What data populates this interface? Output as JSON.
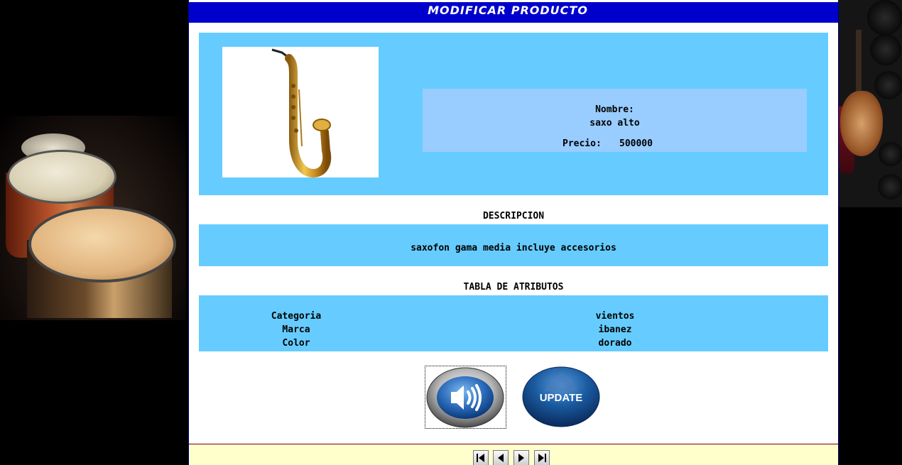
{
  "header": {
    "title": "MODIFICAR PRODUCTO"
  },
  "product": {
    "image_icon": "saxophone-image",
    "name_label": "Nombre:",
    "name_value": "saxo alto",
    "price_label": "Precio:",
    "price_value": "500000"
  },
  "description": {
    "heading": "DESCRIPCION",
    "text": "saxofon gama media incluye accesorios"
  },
  "attributes": {
    "heading": "TABLA DE ATRIBUTOS",
    "rows": [
      {
        "name": "Categoria",
        "value": "vientos"
      },
      {
        "name": "Marca",
        "value": "ibanez"
      },
      {
        "name": "Color",
        "value": "dorado"
      }
    ]
  },
  "actions": {
    "audio_icon": "speaker-icon",
    "update_label": "UPDATE"
  },
  "pager": {
    "icons": [
      "first-page-icon",
      "previous-page-icon",
      "next-page-icon",
      "last-page-icon"
    ]
  },
  "colors": {
    "title_bar": "#0000cc",
    "box_bg": "#66ccff",
    "info_bg": "#99ccff",
    "footer_bg": "#ffffcc"
  }
}
